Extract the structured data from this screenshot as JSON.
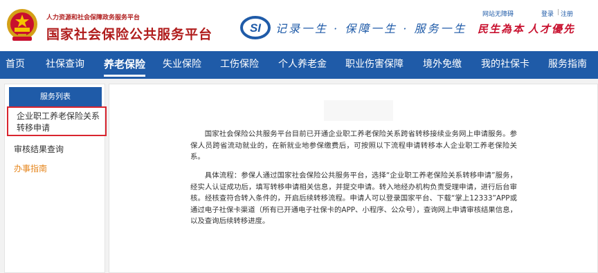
{
  "header": {
    "subtitle": "人力资源和社会保障政务服务平台",
    "title": "国家社会保险公共服务平台",
    "logo_text": "SI",
    "slogan": "记录一生 · 保障一生 · 服务一生",
    "accessible_link": "网站无障碍",
    "login_link": "登录",
    "link_separator": "|",
    "register_link": "注册",
    "motto_left": "民生為本",
    "motto_right": "人才優先"
  },
  "nav": {
    "items": [
      "首页",
      "社保查询",
      "养老保险",
      "失业保险",
      "工伤保险",
      "个人养老金",
      "职业伤害保障",
      "境外免缴",
      "我的社保卡",
      "服务指南"
    ],
    "active_index": 2
  },
  "sidebar": {
    "heading": "服务列表",
    "items": [
      "企业职工养老保险关系转移申请",
      "审核结果查询",
      "办事指南"
    ],
    "selected_index": 0
  },
  "content": {
    "paragraph_1": "国家社会保险公共服务平台目前已开通企业职工养老保险关系跨省转移接续业务网上申请服务。参保人员跨省流动就业的，在新就业地参保缴费后，可按照以下流程申请转移本人企业职工养老保险关系。",
    "paragraph_2": "具体流程：参保人通过国家社会保险公共服务平台，选择“企业职工养老保险关系转移申请”服务，经实人认证成功后，填写转移申请相关信息，并提交申请。转入地经办机构负责受理申请，进行后台审核。经核查符合转入条件的，开启后续转移流程。申请人可以登录国家平台、下载“掌上12333”APP或通过电子社保卡渠道（所有已开通电子社保卡的APP、小程序、公众号），查询网上申请审核结果信息，以及查询后续转移进度。"
  },
  "colors": {
    "brand_blue": "#1f5ba8",
    "brand_red": "#b01c1c",
    "highlight_red": "#d9242e",
    "guide_orange": "#e6861d"
  },
  "icons": {
    "emblem": "national-emblem-icon",
    "logo": "si-logo-icon"
  }
}
